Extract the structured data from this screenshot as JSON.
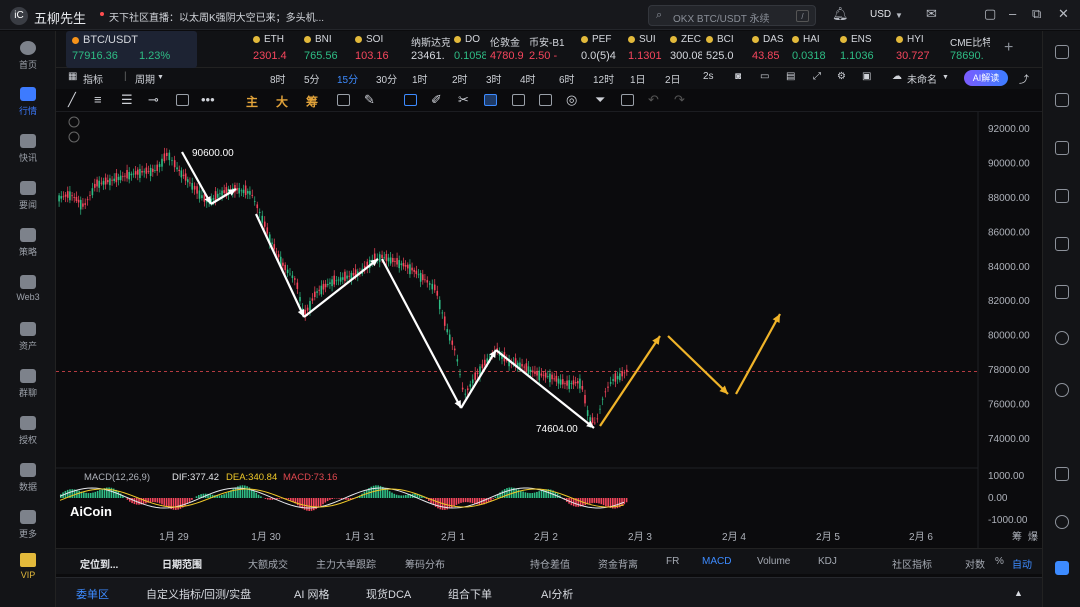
{
  "app": {
    "logo": "iC",
    "name": "五柳先生",
    "news": "天下社区直播：以太周K强阴大空已来；多头机...",
    "search_placeholder": "OKX BTC/USDT 永续",
    "search_key": "/",
    "currency": "USD"
  },
  "sidebar": [
    {
      "label": "首页",
      "icon": "home-icon"
    },
    {
      "label": "行情",
      "icon": "chart-bar-icon"
    },
    {
      "label": "快讯",
      "icon": "news-icon"
    },
    {
      "label": "要闻",
      "icon": "article-icon"
    },
    {
      "label": "策略",
      "icon": "robot-icon"
    },
    {
      "label": "Web3",
      "icon": "web3-icon"
    },
    {
      "label": "资产",
      "icon": "wallet-icon"
    },
    {
      "label": "群聊",
      "icon": "chat-icon"
    },
    {
      "label": "授权",
      "icon": "key-icon"
    },
    {
      "label": "数据",
      "icon": "data-icon"
    },
    {
      "label": "更多",
      "icon": "more-icon"
    },
    {
      "label": "VIP",
      "icon": "vip-icon"
    }
  ],
  "tickers": [
    {
      "name": "BTC/USDT",
      "price": "77916.36",
      "change": "1.23%",
      "color": "#2ebd85"
    },
    {
      "name": "ETH",
      "price": "2301.4",
      "color": "#f6465d"
    },
    {
      "name": "BNI",
      "price": "765.56",
      "color": "#2ebd85"
    },
    {
      "name": "SOI",
      "price": "103.16",
      "color": "#f6465d"
    },
    {
      "name": "纳斯达克",
      "price": "23461.",
      "color": "#d5d8de"
    },
    {
      "name": "DO",
      "price": "0.1058",
      "color": "#2ebd85"
    },
    {
      "name": "伦敦金",
      "price": "4780.9",
      "color": "#f6465d"
    },
    {
      "name": "币安-B1",
      "price": "2.50 -",
      "color": "#f6465d"
    },
    {
      "name": "PEF",
      "price": "0.0(5)4",
      "color": "#d5d8de"
    },
    {
      "name": "SUI",
      "price": "1.1301",
      "color": "#f6465d"
    },
    {
      "name": "ZEC",
      "price": "300.08",
      "color": "#d5d8de"
    },
    {
      "name": "BCI",
      "price": "525.0",
      "color": "#d5d8de"
    },
    {
      "name": "DAS",
      "price": "43.85",
      "color": "#f6465d"
    },
    {
      "name": "HAI",
      "price": "0.0318",
      "color": "#2ebd85"
    },
    {
      "name": "ENS",
      "price": "1.1036",
      "color": "#2ebd85"
    },
    {
      "name": "HYI",
      "price": "30.727",
      "color": "#f6465d"
    },
    {
      "name": "CME比特",
      "price": "78690.",
      "color": "#2ebd85"
    }
  ],
  "toolbar": {
    "indicator": "指标",
    "period": "周期",
    "intervals": [
      "8时",
      "5分",
      "15分",
      "30分",
      "1时",
      "2时",
      "3时",
      "4时",
      "6时",
      "12时",
      "1日",
      "2日",
      "2s"
    ],
    "active_interval": "15分",
    "unnamed": "未命名",
    "ai": "AI解读"
  },
  "draw_tools": {
    "main": "主",
    "big": "大",
    "chip": "筹"
  },
  "chart": {
    "price_ticks": [
      "92000.00",
      "90000.00",
      "88000.00",
      "86000.00",
      "84000.00",
      "82000.00",
      "80000.00",
      "78000.00",
      "76000.00",
      "74000.00"
    ],
    "date_ticks": [
      "1月 29",
      "1月 30",
      "1月 31",
      "2月 1",
      "2月 2",
      "2月 3",
      "2月 4",
      "2月 5",
      "2月 6"
    ],
    "high_label": "90600.00",
    "low_label": "74604.00",
    "watermark": "AiCoin",
    "macd_label": "MACD(12,26,9)",
    "dif": "DIF:377.42",
    "dea": "DEA:340.84",
    "macd": "MACD:73.16",
    "macd_ticks": [
      "1000.00",
      "0.00",
      "-1000.00"
    ],
    "corner_labels": [
      "筹",
      "爆"
    ]
  },
  "bottom_tabs": {
    "left": [
      "定位到...",
      "日期范围",
      "大额成交",
      "主力大单跟踪",
      "筹码分布"
    ],
    "right": [
      "持仓差值",
      "资金背离",
      "FR",
      "MACD",
      "Volume",
      "KDJ",
      "社区指标",
      "对数",
      "%",
      "自动"
    ],
    "active": "MACD"
  },
  "bottom_nav": [
    "委单区",
    "自定义指标/回测/实盘",
    "AI 网格",
    "现货DCA",
    "组合下单",
    "AI分析"
  ]
}
